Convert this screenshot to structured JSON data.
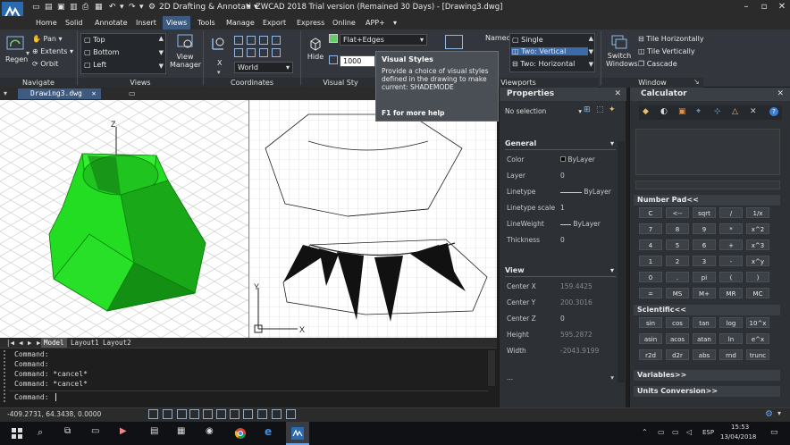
{
  "titlebar": {
    "title": "ZWCAD 2018 Trial version (Remained 30 Days) - [Drawing3.dwg]",
    "workspace": "2D Drafting & Annotati",
    "logo": "zwcad-logo-icon"
  },
  "menu": {
    "tabs": [
      "Home",
      "Solid",
      "Annotate",
      "Insert",
      "Views",
      "Tools",
      "Manage",
      "Export",
      "Express",
      "Online",
      "APP+"
    ],
    "active": "Views"
  },
  "ribbon": {
    "navigate": {
      "label": "Navigate",
      "regen": "Regen",
      "pan": "Pan",
      "extents": "Extents",
      "orbit": "Orbit"
    },
    "views": {
      "label": "Views",
      "items": [
        "Top",
        "Bottom",
        "Left"
      ],
      "view_manager": "View\nManager"
    },
    "coordinates": {
      "label": "Coordinates",
      "ucs": "World",
      "x_label": "X"
    },
    "visual": {
      "label": "Visual Sty",
      "hide": "Hide",
      "style": "Flat+Edges",
      "value": "1000"
    },
    "viewports": {
      "label": "Viewports",
      "named": "Named",
      "options": [
        "Single",
        "Two: Vertical",
        "Two: Horizontal"
      ],
      "selected": "Two: Vertical"
    },
    "window": {
      "label": "Window",
      "switch": "Switch\nWindows",
      "tile_h": "Tile Horizontally",
      "tile_v": "Tile Vertically",
      "cascade": "Cascade"
    }
  },
  "tooltip": {
    "title": "Visual Styles",
    "body": "Provide a choice of visual styles defined in the drawing to make current: SHADEMODE",
    "help": "F1 for more help"
  },
  "doc_tab": "Drawing3.dwg",
  "layout_tabs": [
    "Model",
    "Layout1",
    "Layout2"
  ],
  "command": {
    "history": [
      "Command:",
      "Command:",
      "Command: *cancel*",
      "Command: *cancel*"
    ],
    "prompt": "Command:"
  },
  "status": {
    "coords": "-409.2731, 64.3438, 0.0000"
  },
  "properties": {
    "title": "Properties",
    "selection": "No selection",
    "general_label": "General",
    "general": [
      {
        "name": "Color",
        "value": "ByLayer"
      },
      {
        "name": "Layer",
        "value": "0"
      },
      {
        "name": "Linetype",
        "value": "ByLayer"
      },
      {
        "name": "Linetype scale",
        "value": "1"
      },
      {
        "name": "LineWeight",
        "value": "ByLayer"
      },
      {
        "name": "Thickness",
        "value": "0"
      }
    ],
    "view_label": "View",
    "view": [
      {
        "name": "Center X",
        "value": "159.4425"
      },
      {
        "name": "Center Y",
        "value": "200.3016"
      },
      {
        "name": "Center Z",
        "value": "0"
      },
      {
        "name": "Height",
        "value": "595.2872"
      },
      {
        "name": "Width",
        "value": "-2043.9199"
      }
    ],
    "more": "..."
  },
  "calculator": {
    "title": "Calculator",
    "numpad_label": "Number Pad<<",
    "numpad": [
      "C",
      "<--",
      "sqrt",
      "/",
      "1/x",
      "7",
      "8",
      "9",
      "*",
      "x^2",
      "4",
      "5",
      "6",
      "+",
      "x^3",
      "1",
      "2",
      "3",
      "-",
      "x^y",
      "0",
      ".",
      "pi",
      "(",
      ")",
      "=",
      "MS",
      "M+",
      "MR",
      "MC"
    ],
    "sci_label": "Scientific<<",
    "sci": [
      "sin",
      "cos",
      "tan",
      "log",
      "10^x",
      "asin",
      "acos",
      "atan",
      "ln",
      "e^x",
      "r2d",
      "d2r",
      "abs",
      "rnd",
      "trunc"
    ],
    "variables_label": "Variables>>",
    "units_label": "Units Conversion>>"
  },
  "taskbar": {
    "time": "15:53",
    "date": "13/04/2018",
    "lang": "ESP"
  },
  "axes": {
    "z": "Z",
    "y": "Y",
    "x": "X"
  }
}
